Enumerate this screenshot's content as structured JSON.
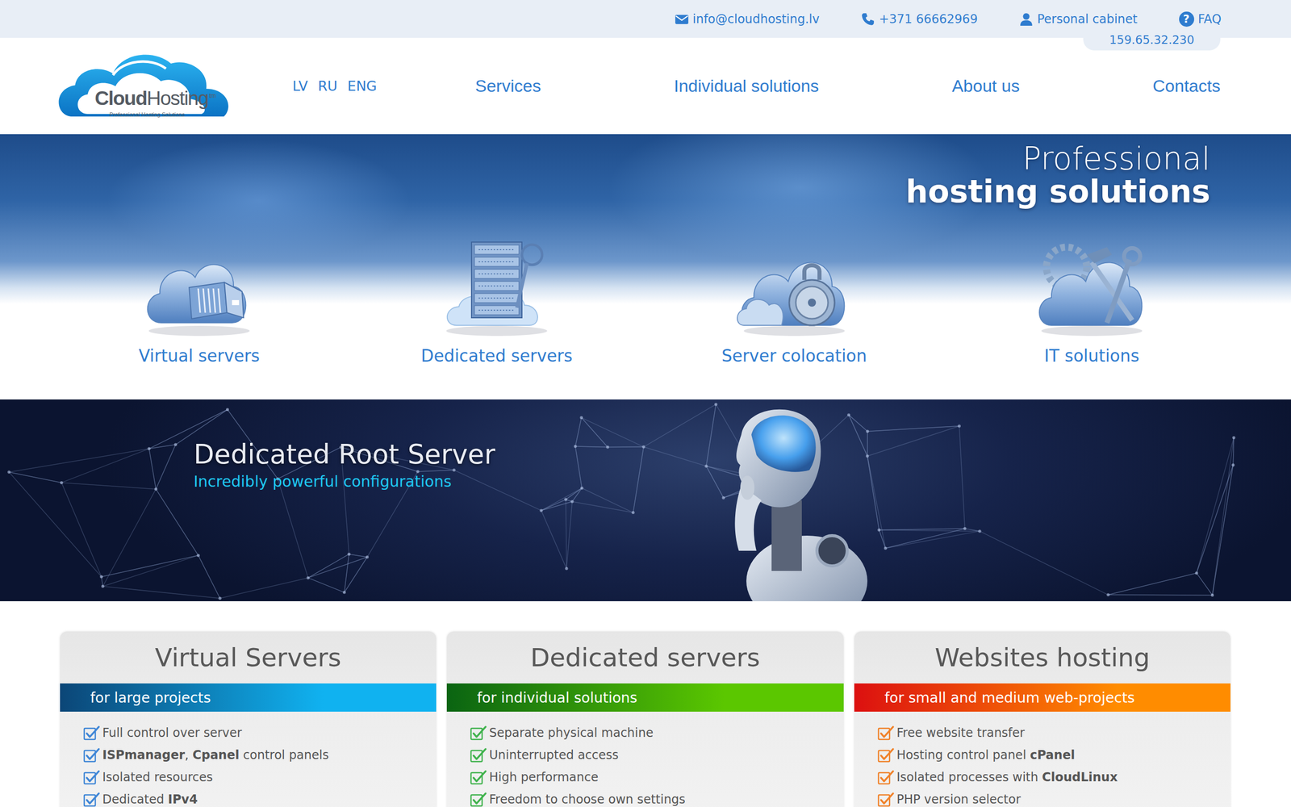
{
  "topbar": {
    "email": "info@cloudhosting.lv",
    "phone": "+371 66662969",
    "cabinet": "Personal cabinet",
    "faq": {
      "icon": "?",
      "label": "FAQ"
    },
    "ip": "159.65.32.230"
  },
  "logo": {
    "bold": "Cloud",
    "light": "Hosting",
    "tm": "tm",
    "tagline": "Professional Hosting Solutions"
  },
  "languages": [
    "LV",
    "RU",
    "ENG"
  ],
  "nav": [
    "Services",
    "Individual solutions",
    "About us",
    "Contacts"
  ],
  "hero": {
    "title_light": "Professional",
    "title_bold": "hosting solutions",
    "tiles": [
      {
        "label": "Virtual servers",
        "kind": "storage"
      },
      {
        "label": "Dedicated servers",
        "kind": "rack"
      },
      {
        "label": "Server colocation",
        "kind": "lock"
      },
      {
        "label": "IT solutions",
        "kind": "tools"
      }
    ]
  },
  "banner": {
    "title": "Dedicated Root Server",
    "subtitle": "Incredibly powerful configurations"
  },
  "plans": [
    {
      "title": "Virtual Servers",
      "subtitle": "for large projects",
      "color": "#3f86d6",
      "strip": [
        "#0b4677",
        "#10b2f0"
      ],
      "features": [
        [
          {
            "text": "Full control over server",
            "bold": false
          }
        ],
        [
          {
            "text": "ISPmanager",
            "bold": true
          },
          {
            "text": ", ",
            "bold": false
          },
          {
            "text": "Cpanel",
            "bold": true
          },
          {
            "text": " control panels",
            "bold": false
          }
        ],
        [
          {
            "text": "Isolated resources",
            "bold": false
          }
        ],
        [
          {
            "text": "Dedicated ",
            "bold": false
          },
          {
            "text": "IPv4",
            "bold": true
          }
        ]
      ]
    },
    {
      "title": "Dedicated servers",
      "subtitle": "for individual solutions",
      "color": "#3fb24c",
      "strip": [
        "#0a6412",
        "#5bc700"
      ],
      "features": [
        [
          {
            "text": "Separate physical machine",
            "bold": false
          }
        ],
        [
          {
            "text": "Uninterrupted access",
            "bold": false
          }
        ],
        [
          {
            "text": "High performance",
            "bold": false
          }
        ],
        [
          {
            "text": "Freedom to choose own settings",
            "bold": false
          }
        ]
      ]
    },
    {
      "title": "Websites hosting",
      "subtitle": "for small and medium web-projects",
      "color": "#f0822a",
      "strip": [
        "#dc1010",
        "#ff8c00"
      ],
      "features": [
        [
          {
            "text": "Free website transfer",
            "bold": false
          }
        ],
        [
          {
            "text": "Hosting control panel ",
            "bold": false
          },
          {
            "text": "cPanel",
            "bold": true
          }
        ],
        [
          {
            "text": "Isolated processes with ",
            "bold": false
          },
          {
            "text": "CloudLinux",
            "bold": true
          }
        ],
        [
          {
            "text": "PHP version selector",
            "bold": false
          }
        ]
      ]
    }
  ]
}
